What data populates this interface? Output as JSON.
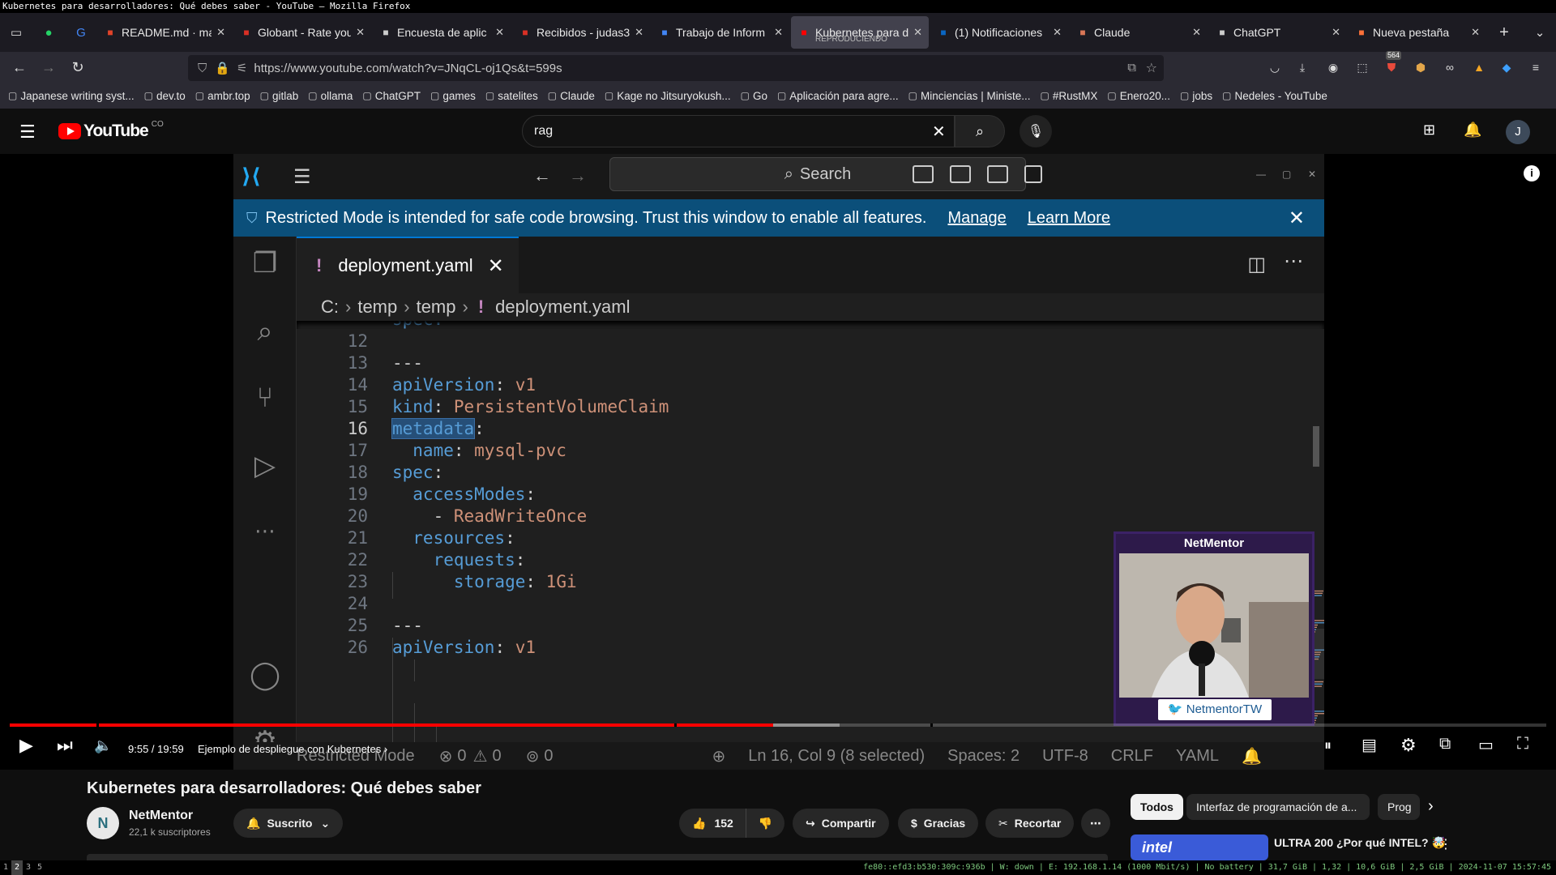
{
  "window_title": "Kubernetes para desarrolladores: Qué debes saber - YouTube — Mozilla Firefox",
  "tabs": [
    {
      "label": "README.md · mai",
      "icon": "gitlab-icon",
      "color": "#e24329",
      "w": 166
    },
    {
      "label": "Globant - Rate you",
      "icon": "gmail-icon",
      "color": "#d93025",
      "w": 170
    },
    {
      "label": "Encuesta de aplic",
      "icon": "form-icon",
      "color": "#cccccc",
      "w": 170
    },
    {
      "label": "Recibidos - judas3",
      "icon": "gmail-icon",
      "color": "#d93025",
      "w": 170
    },
    {
      "label": "Trabajo de Inform",
      "icon": "doc-icon",
      "color": "#4285f4",
      "w": 170
    },
    {
      "label": "Kubernetes para d",
      "sub": "REPRODUCIENDO",
      "icon": "youtube-icon",
      "color": "#ff0000",
      "w": 170,
      "active": true
    },
    {
      "label": "(1) Notificaciones",
      "icon": "linkedin-icon",
      "color": "#0a66c2",
      "w": 170
    },
    {
      "label": "Claude",
      "icon": "claude-icon",
      "color": "#d97757",
      "w": 170
    },
    {
      "label": "ChatGPT",
      "icon": "chatgpt-icon",
      "color": "#cccccc",
      "w": 170
    },
    {
      "label": "Nueva pestaña",
      "icon": "firefox-icon",
      "color": "#ff7139",
      "w": 170
    }
  ],
  "url": "https://www.youtube.com/watch?v=JNqCL-oj1Qs&t=599s",
  "badge_count": "564",
  "bookmarks": [
    "Japanese writing syst...",
    "dev.to",
    "ambr.top",
    "gitlab",
    "ollama",
    "ChatGPT",
    "games",
    "satelites",
    "Claude",
    "Kage no Jitsuryokush...",
    "Go",
    "Aplicación para agre...",
    "Minciencias | Ministe...",
    "#RustMX",
    "Enero20...",
    "jobs",
    "Nedeles - YouTube"
  ],
  "youtube": {
    "country": "CO",
    "search_value": "rag",
    "avatar_letter": "J"
  },
  "vscode": {
    "search_placeholder": "Search",
    "banner_text": "Restricted Mode is intended for safe code browsing. Trust this window to enable all features.",
    "banner_manage": "Manage",
    "banner_learn": "Learn More",
    "tab_file": "deployment.yaml",
    "breadcrumb": [
      "C:",
      "temp",
      "temp",
      "deployment.yaml"
    ],
    "partial_line": "spec:",
    "lines": [
      {
        "n": "12",
        "parts": []
      },
      {
        "n": "13",
        "parts": [
          {
            "t": "---",
            "c": "p"
          }
        ]
      },
      {
        "n": "14",
        "parts": [
          {
            "t": "apiVersion",
            "c": "k"
          },
          {
            "t": ": ",
            "c": "p"
          },
          {
            "t": "v1",
            "c": "s"
          }
        ]
      },
      {
        "n": "15",
        "parts": [
          {
            "t": "kind",
            "c": "k"
          },
          {
            "t": ": ",
            "c": "p"
          },
          {
            "t": "PersistentVolumeClaim",
            "c": "s"
          }
        ]
      },
      {
        "n": "16",
        "cur": true,
        "parts": [
          {
            "t": "metadata",
            "c": "k sel"
          },
          {
            "t": ":",
            "c": "p"
          }
        ]
      },
      {
        "n": "17",
        "parts": [
          {
            "t": "  name",
            "c": "k"
          },
          {
            "t": ": ",
            "c": "p"
          },
          {
            "t": "mysql-pvc",
            "c": "s"
          }
        ]
      },
      {
        "n": "18",
        "parts": [
          {
            "t": "spec",
            "c": "k"
          },
          {
            "t": ":",
            "c": "p"
          }
        ]
      },
      {
        "n": "19",
        "parts": [
          {
            "t": "  accessModes",
            "c": "k"
          },
          {
            "t": ":",
            "c": "p"
          }
        ]
      },
      {
        "n": "20",
        "parts": [
          {
            "t": "    - ",
            "c": "p"
          },
          {
            "t": "ReadWriteOnce",
            "c": "s"
          }
        ]
      },
      {
        "n": "21",
        "parts": [
          {
            "t": "  resources",
            "c": "k"
          },
          {
            "t": ":",
            "c": "p"
          }
        ]
      },
      {
        "n": "22",
        "parts": [
          {
            "t": "    requests",
            "c": "k"
          },
          {
            "t": ":",
            "c": "p"
          }
        ]
      },
      {
        "n": "23",
        "parts": [
          {
            "t": "      storage",
            "c": "k"
          },
          {
            "t": ": ",
            "c": "p"
          },
          {
            "t": "1Gi",
            "c": "s"
          }
        ]
      },
      {
        "n": "24",
        "parts": []
      },
      {
        "n": "25",
        "parts": [
          {
            "t": "---",
            "c": "p"
          }
        ]
      },
      {
        "n": "26",
        "parts": [
          {
            "t": "apiVersion",
            "c": "k"
          },
          {
            "t": ": ",
            "c": "p"
          },
          {
            "t": "v1",
            "c": "s"
          }
        ]
      }
    ],
    "status": {
      "mode": "Restricted Mode",
      "errors": "0",
      "warnings": "0",
      "ports": "0",
      "position": "Ln 16, Col 9 (8 selected)",
      "spaces": "Spaces: 2",
      "encoding": "UTF-8",
      "eol": "CRLF",
      "language": "YAML"
    }
  },
  "webcam": {
    "name": "NetMentor",
    "twitter": "NetmentorTW"
  },
  "player": {
    "time": "9:55 / 19:59",
    "chapter": "Ejemplo de despliegue con Kubernetes",
    "progress": 0.497,
    "buffered": 0.54
  },
  "video": {
    "title": "Kubernetes para desarrolladores: Qué debes saber",
    "channel": "NetMentor",
    "subscribers": "22,1 k suscriptores",
    "subscribed_label": "Suscrito",
    "likes": "152",
    "share": "Compartir",
    "thanks": "Gracias",
    "clip": "Recortar"
  },
  "chips": [
    "Todos",
    "Interfaz de programación de a...",
    "Prog"
  ],
  "side_video": {
    "thumb_text": "intel",
    "title": "ULTRA 200 ¿Por qué INTEL? 🤯"
  },
  "sysbar": {
    "workspaces": [
      "1",
      "2",
      "3",
      "5"
    ],
    "info": "fe80::efd3:b530:309c:936b | W: down | E: 192.168.1.14 (1000 Mbit/s) | No battery | 31,7 GiB | 1,32 | 10,6 GiB | 2,5 GiB | 2024-11-07 15:57:45"
  }
}
